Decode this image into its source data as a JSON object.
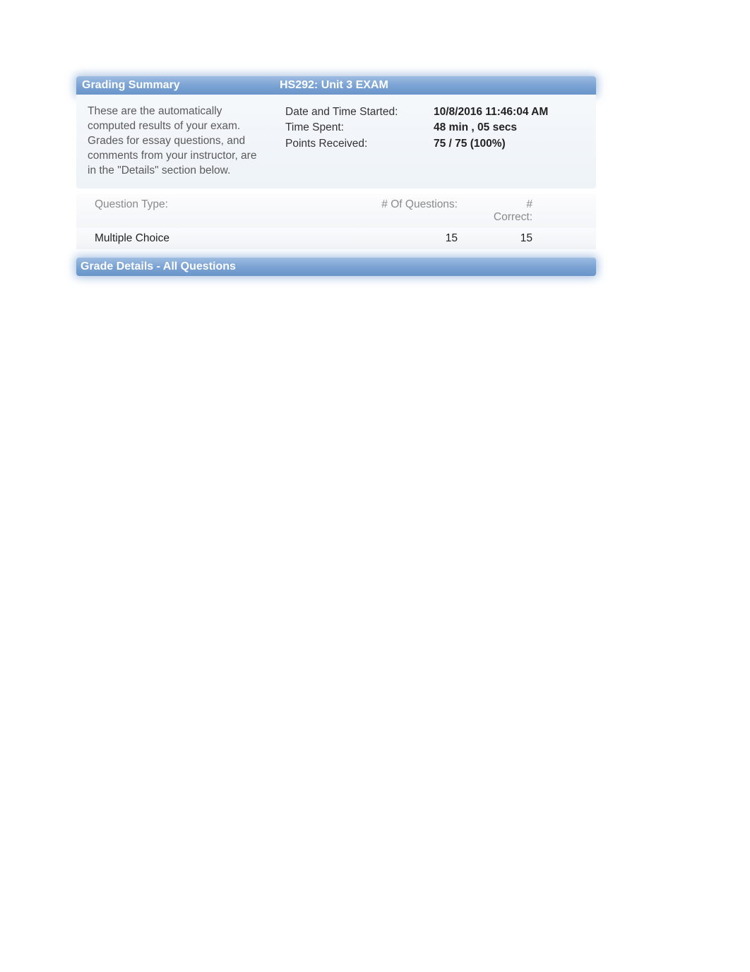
{
  "header": {
    "grading_summary_label": "Grading Summary",
    "exam_title": "HS292: Unit 3 EXAM"
  },
  "summary": {
    "description": "These are the automatically computed results of your exam. Grades for essay questions, and comments from your instructor, are in the \"Details\" section below.",
    "labels": {
      "date_started": "Date and Time Started:",
      "time_spent": "Time Spent:",
      "points_received": "Points Received:"
    },
    "values": {
      "date_started": "10/8/2016 11:46:04 AM",
      "time_spent": "48 min , 05 secs",
      "points_received": "75 / 75 (100%)"
    }
  },
  "table": {
    "headers": {
      "question_type": "Question Type:",
      "num_questions": "# Of Questions:",
      "num_correct": "# Correct:"
    },
    "rows": [
      {
        "type": "Multiple Choice",
        "count": "15",
        "correct": "15"
      }
    ]
  },
  "details_bar": {
    "title": "Grade Details - All Questions"
  }
}
